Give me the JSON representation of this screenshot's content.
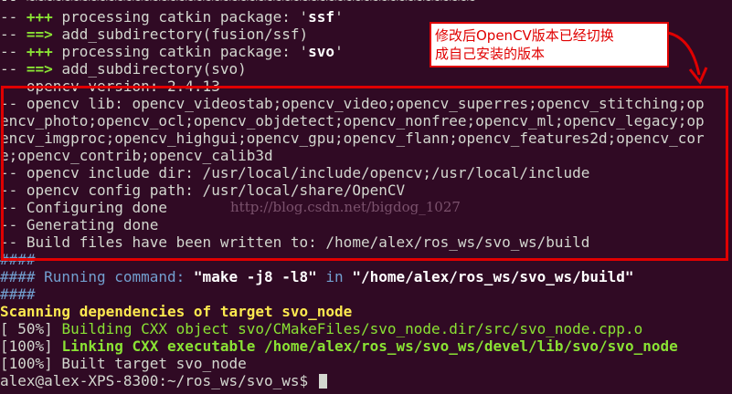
{
  "terminal": {
    "lines": [
      {
        "segs": [
          {
            "t": "-- ",
            "c": "w"
          },
          {
            "t": "~~~~~~~~~~~~~~~~~~~~~~~~~~~~~~~~~~~~~~~~~~~~~~~~~~~",
            "c": "w"
          }
        ]
      },
      {
        "segs": [
          {
            "t": "-- ",
            "c": "w"
          },
          {
            "t": "+++ ",
            "c": "bg"
          },
          {
            "t": "processing catkin package: '",
            "c": "w"
          },
          {
            "t": "ssf",
            "c": "bw"
          },
          {
            "t": "'",
            "c": "w"
          }
        ]
      },
      {
        "segs": [
          {
            "t": "-- ",
            "c": "w"
          },
          {
            "t": "==> ",
            "c": "bg"
          },
          {
            "t": "add_subdirectory(fusion/ssf)",
            "c": "w"
          }
        ]
      },
      {
        "segs": [
          {
            "t": "-- ",
            "c": "w"
          },
          {
            "t": "+++ ",
            "c": "bg"
          },
          {
            "t": "processing catkin package: '",
            "c": "w"
          },
          {
            "t": "svo",
            "c": "bw"
          },
          {
            "t": "'",
            "c": "w"
          }
        ]
      },
      {
        "segs": [
          {
            "t": "-- ",
            "c": "w"
          },
          {
            "t": "==> ",
            "c": "bg"
          },
          {
            "t": "add_subdirectory(svo)",
            "c": "w"
          }
        ]
      },
      {
        "segs": [
          {
            "t": "-- opencv version: 2.4.13",
            "c": "w"
          }
        ]
      },
      {
        "segs": [
          {
            "t": "-- opencv lib: opencv_videostab;opencv_video;opencv_superres;opencv_stitching;op",
            "c": "w"
          }
        ]
      },
      {
        "segs": [
          {
            "t": "encv_photo;opencv_ocl;opencv_objdetect;opencv_nonfree;opencv_ml;opencv_legacy;op",
            "c": "w"
          }
        ]
      },
      {
        "segs": [
          {
            "t": "encv_imgproc;opencv_highgui;opencv_gpu;opencv_flann;opencv_features2d;opencv_cor",
            "c": "w"
          }
        ]
      },
      {
        "segs": [
          {
            "t": "e;opencv_contrib;opencv_calib3d",
            "c": "w"
          }
        ]
      },
      {
        "segs": [
          {
            "t": "-- opencv include dir: /usr/local/include/opencv;/usr/local/include",
            "c": "w"
          }
        ]
      },
      {
        "segs": [
          {
            "t": "-- opencv config path: /usr/local/share/OpenCV",
            "c": "w"
          }
        ]
      },
      {
        "segs": [
          {
            "t": "-- Configuring done",
            "c": "w"
          }
        ]
      },
      {
        "segs": [
          {
            "t": "-- Generating done",
            "c": "w"
          }
        ]
      },
      {
        "segs": [
          {
            "t": "-- Build files have been written to: /home/alex/ros_ws/svo_ws/build",
            "c": "w"
          }
        ]
      },
      {
        "segs": [
          {
            "t": "####",
            "c": "blue"
          }
        ]
      },
      {
        "segs": [
          {
            "t": "#### Running command: ",
            "c": "blue"
          },
          {
            "t": "\"make -j8 -l8\"",
            "c": "bw"
          },
          {
            "t": " in ",
            "c": "blue"
          },
          {
            "t": "\"/home/alex/ros_ws/svo_ws/build\"",
            "c": "bw"
          }
        ]
      },
      {
        "segs": [
          {
            "t": "####",
            "c": "blue"
          }
        ]
      },
      {
        "segs": [
          {
            "t": "Scanning dependencies of target svo_node",
            "c": "byel"
          }
        ]
      },
      {
        "segs": [
          {
            "t": "[ 50%] ",
            "c": "w"
          },
          {
            "t": "Building CXX object svo/CMakeFiles/svo_node.dir/src/svo_node.cpp.o",
            "c": "g"
          }
        ]
      },
      {
        "segs": [
          {
            "t": "[100%] ",
            "c": "w"
          },
          {
            "t": "Linking CXX executable /home/alex/ros_ws/svo_ws/devel/lib/svo/svo_node",
            "c": "bg"
          }
        ]
      },
      {
        "segs": [
          {
            "t": "[100%] Built target svo_node",
            "c": "w"
          }
        ]
      }
    ],
    "prompt": "alex@alex-XPS-8300:~/ros_ws/svo_ws$ "
  },
  "annotation": {
    "note_line1": "修改后OpenCV版本已经切换",
    "note_line2": "成自己安装的版本",
    "color": "#e00000"
  },
  "watermark": "http://blog.csdn.net/bigdog_1027",
  "colors": {
    "background": "#300a24",
    "text": "#d3d7cf",
    "green": "#8ae234",
    "blue": "#729fcf",
    "yellow": "#fce94f"
  }
}
